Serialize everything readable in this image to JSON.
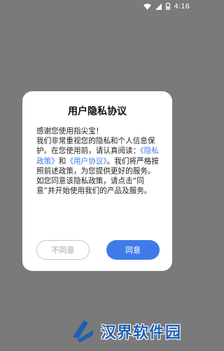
{
  "status_bar": {
    "time": "4:16",
    "icons": [
      "wifi-icon",
      "signal-icon",
      "battery-icon"
    ]
  },
  "dialog": {
    "title": "用户隐私协议",
    "greeting": "感谢您使用指尖宝！",
    "body_part1": "我们非常重视您的隐私和个人信息保护。在您使用前，请认真阅读：",
    "privacy_policy_link": "《隐私政策》",
    "and_text": "和",
    "user_agreement_link": "《用户协议》",
    "body_part2": "。我们将严格按照前述政策，为您提供更好的服务。如您同意该隐私政策，请点击“同意”并开始使用我们的产品及服务。",
    "disagree_label": "不同意",
    "agree_label": "同意"
  },
  "watermark": {
    "text": "汉界软件园"
  },
  "colors": {
    "overlay": "#7a7a7a",
    "accent": "#3f7be8",
    "watermark": "#1e5fb4"
  }
}
